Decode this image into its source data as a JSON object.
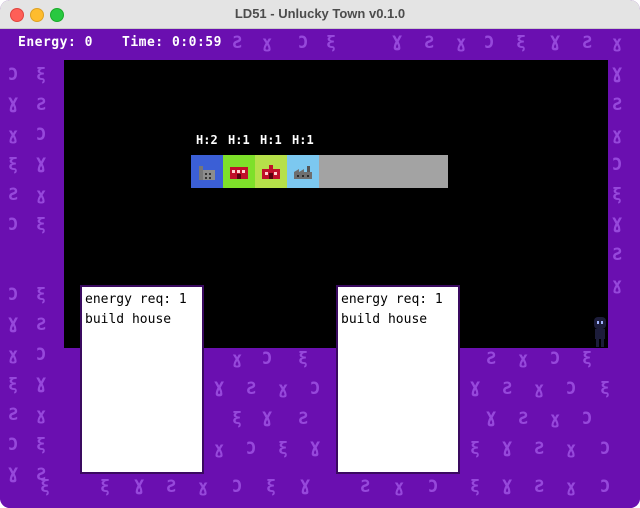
{
  "window": {
    "title": "LD51 - Unlucky Town v0.1.0"
  },
  "hud": {
    "energy": "Energy: 0",
    "time": "Time: 0:0:59"
  },
  "slots": [
    {
      "label": "H:2",
      "color": "#3b5fd6",
      "icon": "factory-icon"
    },
    {
      "label": "H:1",
      "color": "#7ee02a",
      "icon": "house-icon"
    },
    {
      "label": "H:1",
      "color": "#b6e04a",
      "icon": "house-icon"
    },
    {
      "label": "H:1",
      "color": "#7cc8f0",
      "icon": "factory-icon"
    }
  ],
  "cards": [
    {
      "requirement": "energy req: 1",
      "action": "build house"
    },
    {
      "requirement": "energy req: 1",
      "action": "build house"
    }
  ],
  "background_color": "#6a0fb0",
  "accent_glyph_color": "#9b4fe0"
}
